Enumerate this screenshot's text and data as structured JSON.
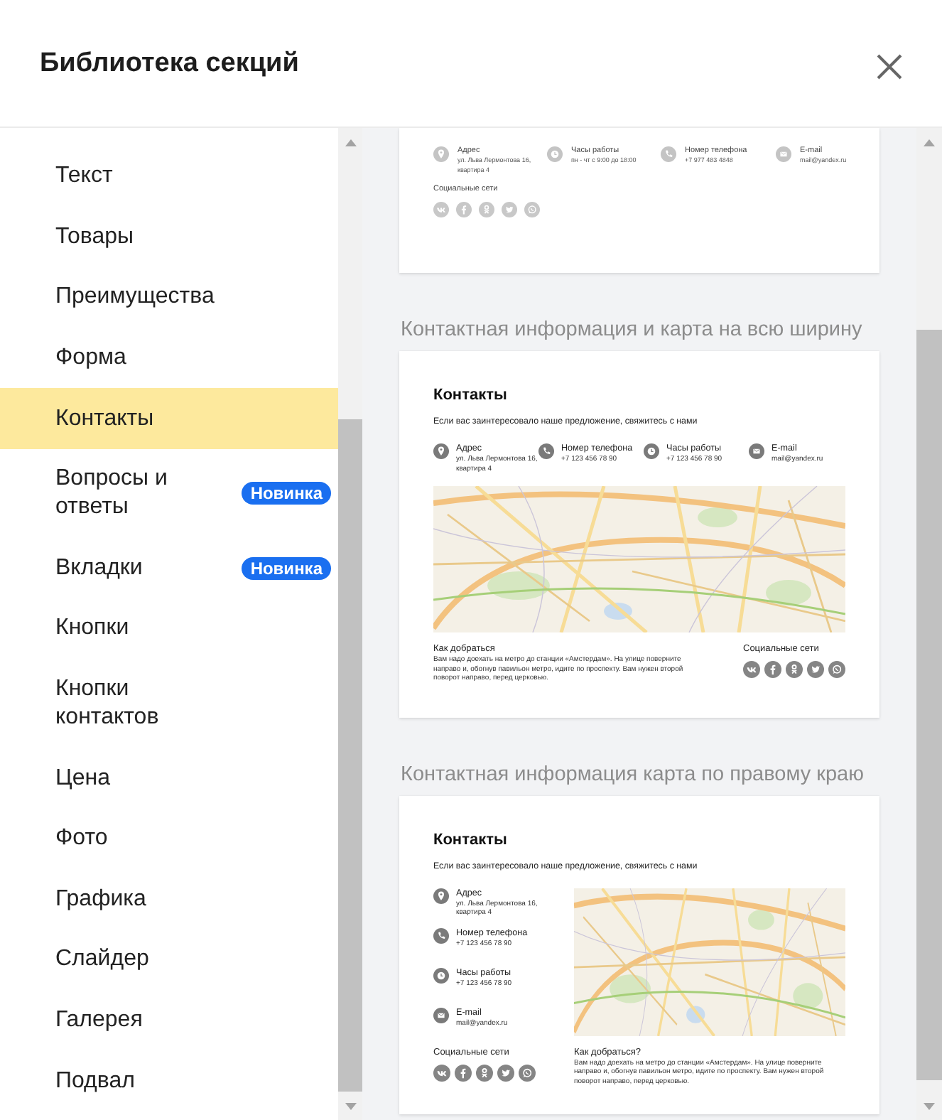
{
  "dialog": {
    "title": "Библиотека секций"
  },
  "sidebar": {
    "items": [
      {
        "label": "Текст",
        "selected": false
      },
      {
        "label": "Товары",
        "selected": false
      },
      {
        "label": "Преимущества",
        "selected": false
      },
      {
        "label": "Форма",
        "selected": false
      },
      {
        "label": "Контакты",
        "selected": true
      },
      {
        "label": "Вопросы и ответы",
        "selected": false,
        "badge": "Новинка"
      },
      {
        "label": "Вкладки",
        "selected": false,
        "badge": "Новинка"
      },
      {
        "label": "Кнопки",
        "selected": false
      },
      {
        "label": "Кнопки контактов",
        "selected": false
      },
      {
        "label": "Цена",
        "selected": false
      },
      {
        "label": "Фото",
        "selected": false
      },
      {
        "label": "Графика",
        "selected": false
      },
      {
        "label": "Слайдер",
        "selected": false
      },
      {
        "label": "Галерея",
        "selected": false
      },
      {
        "label": "Подвал",
        "selected": false
      }
    ]
  },
  "previews": [
    {
      "kind": "row",
      "contacts": [
        {
          "kind": "address",
          "label": "Адрес",
          "value": "ул. Льва Лермонтова 16, квартира 4"
        },
        {
          "kind": "hours",
          "label": "Часы работы",
          "value": "пн - чт с 9:00 до 18:00"
        },
        {
          "kind": "phone",
          "label": "Номер телефона",
          "value": "+7 977 483 4848"
        },
        {
          "kind": "email",
          "label": "E-mail",
          "value": "mail@yandex.ru"
        }
      ],
      "social_label": "Социальные сети"
    },
    {
      "kind": "full-map",
      "title": "Контактная информация и карта на всю ширину",
      "heading": "Контакты",
      "intro": "Если вас заинтересовало наше предложение, свяжитесь с нами",
      "contacts": [
        {
          "kind": "address",
          "label": "Адрес",
          "value": "ул. Льва Лермонтова 16, квартира 4"
        },
        {
          "kind": "phone",
          "label": "Номер телефона",
          "value": "+7 123 456 78 90"
        },
        {
          "kind": "hours",
          "label": "Часы работы",
          "value": "+7 123 456 78 90"
        },
        {
          "kind": "email",
          "label": "E-mail",
          "value": "mail@yandex.ru"
        }
      ],
      "directions_title": "Как добраться",
      "directions": "Вам надо доехать на метро до станции «Амстердам». На улице поверните направо и, обогнув павильон метро, идите по проспекту. Вам нужен второй поворот направо, перед церковью.",
      "social_label": "Социальные сети"
    },
    {
      "kind": "right-map",
      "title": "Контактная информация карта по правому краю",
      "heading": "Контакты",
      "intro": "Если вас заинтересовало наше предложение, свяжитесь с нами",
      "contacts": [
        {
          "kind": "address",
          "label": "Адрес",
          "value": "ул. Льва Лермонтова 16, квартира 4"
        },
        {
          "kind": "phone",
          "label": "Номер телефона",
          "value": "+7 123 456 78 90"
        },
        {
          "kind": "hours",
          "label": "Часы работы",
          "value": "+7 123 456 78 90"
        },
        {
          "kind": "email",
          "label": "E-mail",
          "value": "mail@yandex.ru"
        }
      ],
      "social_label": "Социальные сети",
      "directions_title": "Как добраться?",
      "directions": "Вам надо доехать на метро до станции «Амстердам». На улице поверните направо и, обогнув павильон метро, идите по проспекту. Вам нужен второй поворот направо, перед церковью."
    }
  ]
}
